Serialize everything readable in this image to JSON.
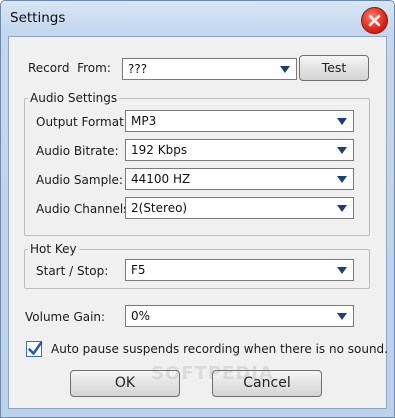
{
  "window": {
    "title": "Settings"
  },
  "record": {
    "label": "Record  From:",
    "value": "???",
    "test_label": "Test"
  },
  "audio": {
    "group_title": "Audio Settings",
    "output_format_label": "Output Format:",
    "output_format_value": "MP3",
    "bitrate_label": "Audio Bitrate:",
    "bitrate_value": "192 Kbps",
    "sample_label": "Audio Sample:",
    "sample_value": "44100 HZ",
    "channels_label": "Audio Channels:",
    "channels_value": "2(Stereo)"
  },
  "hotkey": {
    "group_title": "Hot Key",
    "start_stop_label": "Start / Stop:",
    "start_stop_value": "F5"
  },
  "volume": {
    "label": "Volume Gain:",
    "value": "0%"
  },
  "auto_pause": {
    "label": "Auto pause suspends recording when there is no sound.",
    "checked": true
  },
  "buttons": {
    "ok_label": "OK",
    "cancel_label": "Cancel"
  },
  "watermark": "SOFTPEDIA",
  "colors": {
    "accent": "#1e5fae",
    "close_red": "#d8261a",
    "dropdown_arrow": "#1f3f6e"
  }
}
